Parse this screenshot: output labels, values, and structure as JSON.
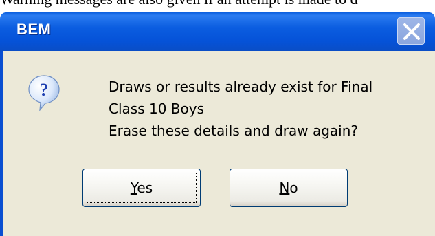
{
  "document": {
    "text_line": "Warning messages are also given if an attempt is made to d"
  },
  "dialog": {
    "title": "BEM",
    "message_lines": [
      "Draws or results already exist for Final",
      "Class 10 Boys",
      "Erase these details and draw again?"
    ],
    "icon": "question-icon",
    "close_icon": "close-icon",
    "buttons": {
      "yes": {
        "mnemonic": "Y",
        "rest": "es",
        "label": "Yes"
      },
      "no": {
        "mnemonic": "N",
        "rest": "o",
        "label": "No"
      }
    }
  },
  "colors": {
    "titlebar": "#0552d8",
    "dialog_body": "#ece9d8",
    "button_border": "#003c74"
  }
}
